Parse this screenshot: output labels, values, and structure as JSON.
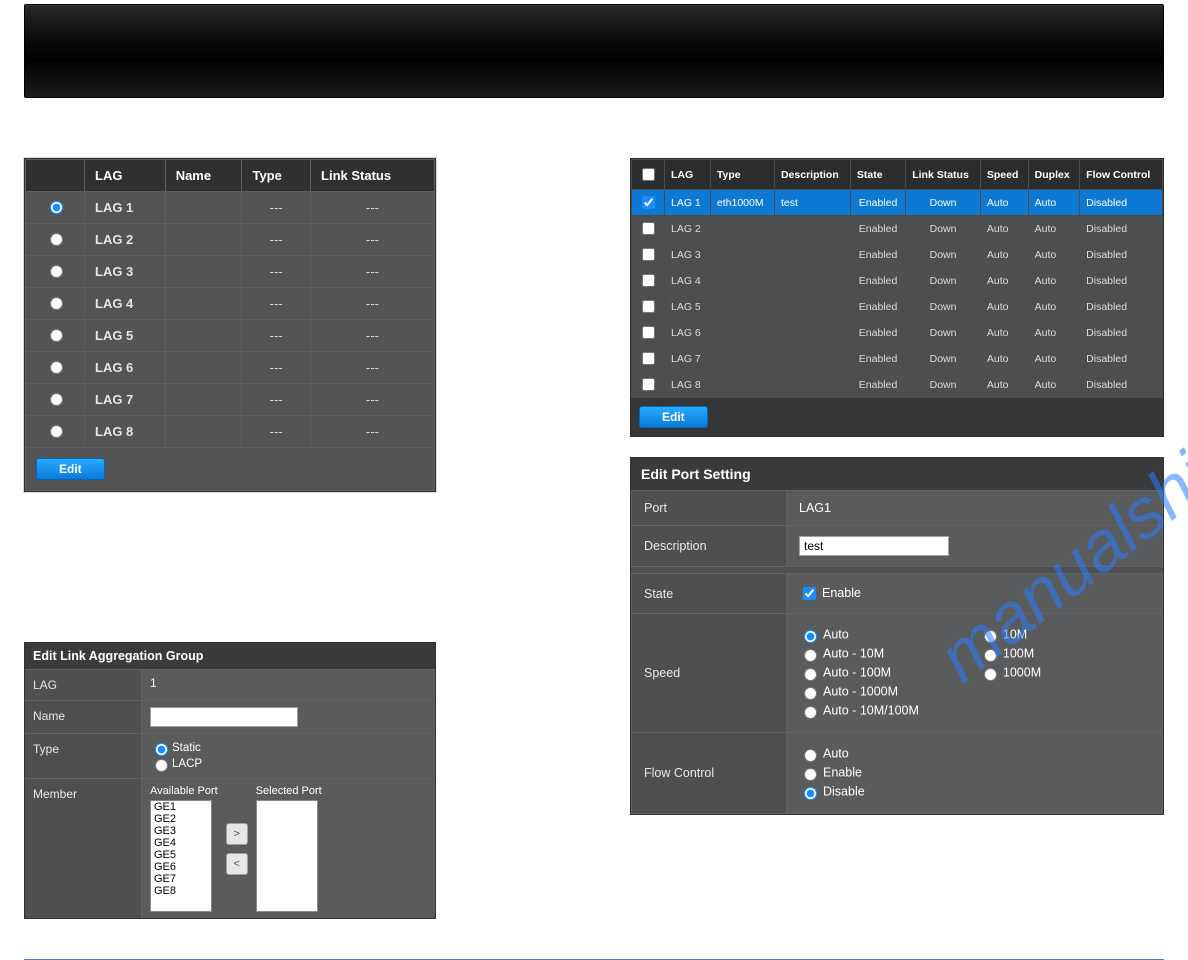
{
  "watermark": "manualshive.com",
  "lag_table": {
    "headers": [
      "",
      "LAG",
      "Name",
      "Type",
      "Link Status"
    ],
    "rows": [
      {
        "selected": true,
        "lag": "LAG 1",
        "name": "",
        "type": "---",
        "link": "---"
      },
      {
        "selected": false,
        "lag": "LAG 2",
        "name": "",
        "type": "---",
        "link": "---"
      },
      {
        "selected": false,
        "lag": "LAG 3",
        "name": "",
        "type": "---",
        "link": "---"
      },
      {
        "selected": false,
        "lag": "LAG 4",
        "name": "",
        "type": "---",
        "link": "---"
      },
      {
        "selected": false,
        "lag": "LAG 5",
        "name": "",
        "type": "---",
        "link": "---"
      },
      {
        "selected": false,
        "lag": "LAG 6",
        "name": "",
        "type": "---",
        "link": "---"
      },
      {
        "selected": false,
        "lag": "LAG 7",
        "name": "",
        "type": "---",
        "link": "---"
      },
      {
        "selected": false,
        "lag": "LAG 8",
        "name": "",
        "type": "---",
        "link": "---"
      }
    ],
    "edit_label": "Edit"
  },
  "edit_lag": {
    "title": "Edit Link Aggregation Group",
    "lag_label": "LAG",
    "lag_value": "1",
    "name_label": "Name",
    "name_value": "",
    "type_label": "Type",
    "type_options": {
      "static": {
        "label": "Static",
        "checked": true
      },
      "lacp": {
        "label": "LACP",
        "checked": false
      }
    },
    "member_label": "Member",
    "avail_header": "Available Port",
    "selected_header": "Selected Port",
    "available_ports": [
      "GE1",
      "GE2",
      "GE3",
      "GE4",
      "GE5",
      "GE6",
      "GE7",
      "GE8"
    ],
    "selected_ports": []
  },
  "status_table": {
    "headers": [
      "",
      "LAG",
      "Type",
      "Description",
      "State",
      "Link Status",
      "Speed",
      "Duplex",
      "Flow Control"
    ],
    "rows": [
      {
        "checked": true,
        "lag": "LAG 1",
        "type": "eth1000M",
        "desc": "test",
        "state": "Enabled",
        "link": "Down",
        "speed": "Auto",
        "duplex": "Auto",
        "flow": "Disabled"
      },
      {
        "checked": false,
        "lag": "LAG 2",
        "type": "",
        "desc": "",
        "state": "Enabled",
        "link": "Down",
        "speed": "Auto",
        "duplex": "Auto",
        "flow": "Disabled"
      },
      {
        "checked": false,
        "lag": "LAG 3",
        "type": "",
        "desc": "",
        "state": "Enabled",
        "link": "Down",
        "speed": "Auto",
        "duplex": "Auto",
        "flow": "Disabled"
      },
      {
        "checked": false,
        "lag": "LAG 4",
        "type": "",
        "desc": "",
        "state": "Enabled",
        "link": "Down",
        "speed": "Auto",
        "duplex": "Auto",
        "flow": "Disabled"
      },
      {
        "checked": false,
        "lag": "LAG 5",
        "type": "",
        "desc": "",
        "state": "Enabled",
        "link": "Down",
        "speed": "Auto",
        "duplex": "Auto",
        "flow": "Disabled"
      },
      {
        "checked": false,
        "lag": "LAG 6",
        "type": "",
        "desc": "",
        "state": "Enabled",
        "link": "Down",
        "speed": "Auto",
        "duplex": "Auto",
        "flow": "Disabled"
      },
      {
        "checked": false,
        "lag": "LAG 7",
        "type": "",
        "desc": "",
        "state": "Enabled",
        "link": "Down",
        "speed": "Auto",
        "duplex": "Auto",
        "flow": "Disabled"
      },
      {
        "checked": false,
        "lag": "LAG 8",
        "type": "",
        "desc": "",
        "state": "Enabled",
        "link": "Down",
        "speed": "Auto",
        "duplex": "Auto",
        "flow": "Disabled"
      }
    ],
    "edit_label": "Edit"
  },
  "edit_port": {
    "title": "Edit Port Setting",
    "port_label": "Port",
    "port_value": "LAG1",
    "desc_label": "Description",
    "desc_value": "test",
    "state_label": "State",
    "state_enable_label": "Enable",
    "state_enabled": true,
    "speed_label": "Speed",
    "speed_options_left": [
      {
        "label": "Auto",
        "checked": true
      },
      {
        "label": "Auto - 10M",
        "checked": false
      },
      {
        "label": "Auto - 100M",
        "checked": false
      },
      {
        "label": "Auto - 1000M",
        "checked": false
      },
      {
        "label": "Auto - 10M/100M",
        "checked": false
      }
    ],
    "speed_options_right": [
      {
        "label": "10M",
        "checked": false
      },
      {
        "label": "100M",
        "checked": false
      },
      {
        "label": "1000M",
        "checked": false
      }
    ],
    "flow_label": "Flow Control",
    "flow_options": [
      {
        "label": "Auto",
        "checked": false
      },
      {
        "label": "Enable",
        "checked": false
      },
      {
        "label": "Disable",
        "checked": true
      }
    ]
  }
}
